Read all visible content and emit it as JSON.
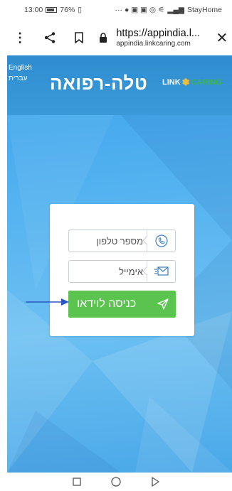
{
  "status_bar": {
    "time": "13:00",
    "battery": "76%",
    "right_text": "StayHome"
  },
  "browser": {
    "url_main": "https://appindia.l...",
    "url_domain": "appindia.linkcaring.com"
  },
  "page": {
    "language_options": [
      "English",
      "עברית"
    ],
    "title": "טלה-רפואה",
    "logo": {
      "part1": "LINK",
      "part2": "CARING"
    }
  },
  "form": {
    "phone_placeholder": "מספר טלפון",
    "email_placeholder": "אימייל",
    "submit_label": "כניסה לוידאו"
  },
  "colors": {
    "header_blue": "#2f8dcf",
    "background_blue": "#55b3f0",
    "submit_green": "#5ac44f",
    "logo_green": "#3ab54a",
    "logo_gold": "#eec03a",
    "arrow_blue": "#2b57c5"
  },
  "icons": {
    "phone": "phone-icon",
    "email": "envelope-icon",
    "submit": "send-icon"
  }
}
